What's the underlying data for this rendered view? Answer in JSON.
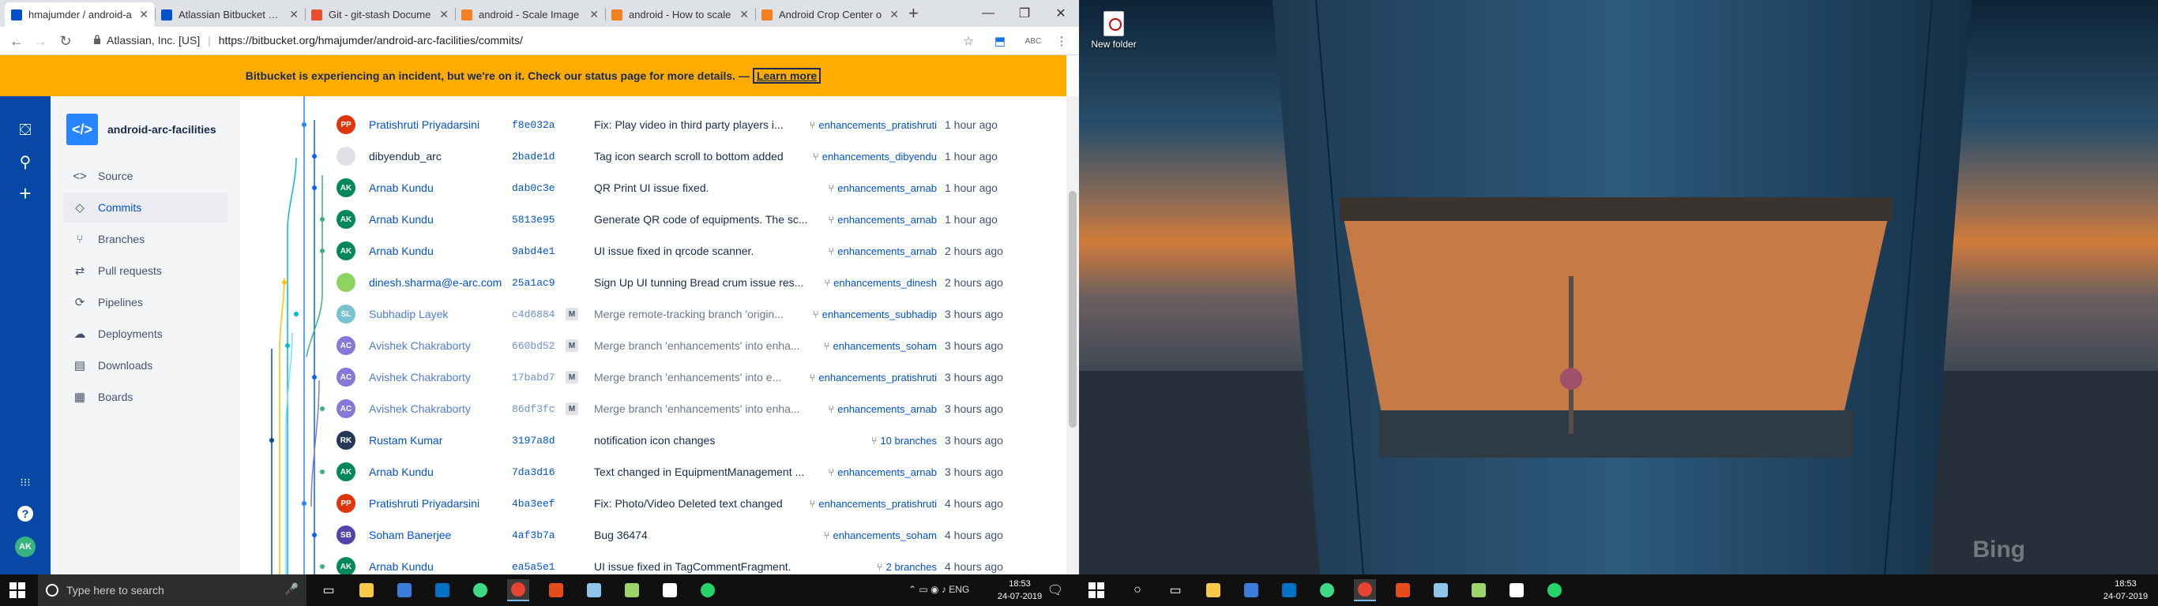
{
  "browser": {
    "tabs": [
      {
        "title": "hmajumder / android-a",
        "color": "#0052cc",
        "active": true
      },
      {
        "title": "Atlassian Bitbucket Sta",
        "color": "#0052cc",
        "active": false
      },
      {
        "title": "Git - git-stash Docume",
        "color": "#e84e31",
        "active": false
      },
      {
        "title": "android - Scale Image",
        "color": "#f48024",
        "active": false
      },
      {
        "title": "android - How to scale",
        "color": "#f48024",
        "active": false
      },
      {
        "title": "Android Crop Center o",
        "color": "#f48024",
        "active": false
      }
    ],
    "new_tab_glyph": "+",
    "window_controls": [
      "—",
      "❐",
      "✕"
    ],
    "nav": {
      "back": "←",
      "forward": "→",
      "reload": "↻"
    },
    "url_org": "Atlassian, Inc. [US]",
    "url_sep": "|",
    "url": "https://bitbucket.org/hmajumder/android-arc-facilities/commits/",
    "omni_icons": [
      "☆",
      "⬒",
      "ABC",
      "⋮"
    ]
  },
  "banner": {
    "text": "Bitbucket is experiencing an incident, but we're on it. Check our status page for more details. —",
    "link": "Learn more"
  },
  "global_nav": {
    "icons": [
      "⛋",
      "⚲",
      "+"
    ],
    "bottom_icons": [
      "⁝⁝⁝",
      "?"
    ],
    "avatar": "AK"
  },
  "sidebar": {
    "repo_icon": "</>",
    "repo_name": "android-arc-facilities",
    "items": [
      {
        "label": "Source",
        "icon": "<>",
        "active": false
      },
      {
        "label": "Commits",
        "icon": "◇",
        "active": true
      },
      {
        "label": "Branches",
        "icon": "⑂",
        "active": false
      },
      {
        "label": "Pull requests",
        "icon": "⇄",
        "active": false
      },
      {
        "label": "Pipelines",
        "icon": "⟳",
        "active": false
      },
      {
        "label": "Deployments",
        "icon": "☁",
        "active": false
      },
      {
        "label": "Downloads",
        "icon": "▤",
        "active": false
      },
      {
        "label": "Boards",
        "icon": "▦",
        "active": false
      }
    ]
  },
  "commits": [
    {
      "author": "Pratishruti Priyadarsini",
      "initials": "PP",
      "color": "#de350b",
      "hash": "f8e032a",
      "merge": false,
      "message": "Fix: Play video in third party players i...",
      "branch": "enhancements_pratishruti",
      "time": "1 hour ago",
      "faded": false
    },
    {
      "author": "dibyendub_arc",
      "initials": "",
      "color": "#dfe1e6",
      "hash": "2bade1d",
      "merge": false,
      "message": "Tag icon search scroll to bottom added",
      "branch": "enhancements_dibyendu",
      "time": "1 hour ago",
      "faded": false,
      "plain": true
    },
    {
      "author": "Arnab Kundu",
      "initials": "AK",
      "color": "#00875a",
      "hash": "dab0c3e",
      "merge": false,
      "message": "QR Print UI issue fixed.",
      "branch": "enhancements_arnab",
      "time": "1 hour ago",
      "faded": false
    },
    {
      "author": "Arnab Kundu",
      "initials": "AK",
      "color": "#00875a",
      "hash": "5813e95",
      "merge": false,
      "message": "Generate QR code of equipments. The sc...",
      "branch": "enhancements_arnab",
      "time": "1 hour ago",
      "faded": false
    },
    {
      "author": "Arnab Kundu",
      "initials": "AK",
      "color": "#00875a",
      "hash": "9abd4e1",
      "merge": false,
      "message": "UI issue fixed in qrcode scanner.",
      "branch": "enhancements_arnab",
      "time": "2 hours ago",
      "faded": false
    },
    {
      "author": "dinesh.sharma@e-arc.com",
      "initials": "",
      "color": "#8dd35f",
      "hash": "25a1ac9",
      "merge": false,
      "message": "Sign Up UI tunning Bread crum issue res...",
      "branch": "enhancements_dinesh",
      "time": "2 hours ago",
      "faded": false
    },
    {
      "author": "Subhadip Layek",
      "initials": "SL",
      "color": "#79c2d0",
      "hash": "c4d6884",
      "merge": true,
      "message": "Merge remote-tracking branch 'origin...",
      "branch": "enhancements_subhadip",
      "time": "3 hours ago",
      "faded": true
    },
    {
      "author": "Avishek Chakraborty",
      "initials": "AC",
      "color": "#8777d9",
      "hash": "660bd52",
      "merge": true,
      "message": "Merge branch 'enhancements' into enha...",
      "branch": "enhancements_soham",
      "time": "3 hours ago",
      "faded": true
    },
    {
      "author": "Avishek Chakraborty",
      "initials": "AC",
      "color": "#8777d9",
      "hash": "17babd7",
      "merge": true,
      "message": "Merge branch 'enhancements' into e...",
      "branch": "enhancements_pratishruti",
      "time": "3 hours ago",
      "faded": true
    },
    {
      "author": "Avishek Chakraborty",
      "initials": "AC",
      "color": "#8777d9",
      "hash": "86df3fc",
      "merge": true,
      "message": "Merge branch 'enhancements' into enha...",
      "branch": "enhancements_arnab",
      "time": "3 hours ago",
      "faded": true
    },
    {
      "author": "Rustam Kumar",
      "initials": "RK",
      "color": "#253858",
      "hash": "3197a8d",
      "merge": false,
      "message": "notification icon changes",
      "branch": "10 branches",
      "time": "3 hours ago",
      "faded": false
    },
    {
      "author": "Arnab Kundu",
      "initials": "AK",
      "color": "#00875a",
      "hash": "7da3d16",
      "merge": false,
      "message": "Text changed in EquipmentManagement ...",
      "branch": "enhancements_arnab",
      "time": "3 hours ago",
      "faded": false
    },
    {
      "author": "Pratishruti Priyadarsini",
      "initials": "PP",
      "color": "#de350b",
      "hash": "4ba3eef",
      "merge": false,
      "message": "Fix: Photo/Video Deleted text changed",
      "branch": "enhancements_pratishruti",
      "time": "4 hours ago",
      "faded": false
    },
    {
      "author": "Soham Banerjee",
      "initials": "SB",
      "color": "#5243aa",
      "hash": "4af3b7a",
      "merge": false,
      "message": "Bug 36474",
      "branch": "enhancements_soham",
      "time": "4 hours ago",
      "faded": false
    },
    {
      "author": "Arnab Kundu",
      "initials": "AK",
      "color": "#00875a",
      "hash": "ea5a5e1",
      "merge": false,
      "message": "UI issue fixed in TagCommentFragment.",
      "branch": "2 branches",
      "time": "4 hours ago",
      "faded": false
    }
  ],
  "desktop": {
    "icon_label": "New folder",
    "watermark": "Bing"
  },
  "taskbar": {
    "search_placeholder": "Type here to search",
    "time": "18:53",
    "date": "24-07-2019",
    "tray": "⌃ ▭ ◉ ♪ ENG"
  }
}
